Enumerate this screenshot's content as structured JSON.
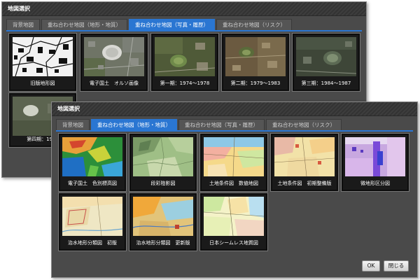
{
  "back_dialog": {
    "title": "地図選択",
    "tabs": [
      {
        "label": "背景地図",
        "active": false
      },
      {
        "label": "重ね合わせ地図（地形・地質）",
        "active": false
      },
      {
        "label": "重ね合わせ地図（写真・履歴）",
        "active": true
      },
      {
        "label": "重ね合わせ地図（リスク）",
        "active": false
      }
    ],
    "thumbnails": [
      {
        "caption": "旧版地形図",
        "image": "old-topographic-map"
      },
      {
        "caption": "電子国土　オルソ画像",
        "image": "ortho-aerial-photo"
      },
      {
        "caption": "第一期：1974～1978",
        "image": "aerial-photo-1974-1978"
      },
      {
        "caption": "第二期：1979～1983",
        "image": "aerial-photo-1979-1983"
      },
      {
        "caption": "第三期：1984～1987",
        "image": "aerial-photo-1984-1987"
      },
      {
        "caption": "第四期：1988",
        "image": "aerial-photo-1988"
      }
    ]
  },
  "front_dialog": {
    "title": "地図選択",
    "tabs": [
      {
        "label": "背景地図",
        "active": false
      },
      {
        "label": "重ね合わせ地図（地形・地質）",
        "active": true
      },
      {
        "label": "重ね合わせ地図（写真・履歴）",
        "active": false
      },
      {
        "label": "重ね合わせ地図（リスク）",
        "active": false
      }
    ],
    "thumbnails": [
      {
        "caption": "電子国土　色別標高図",
        "image": "color-elevation-map"
      },
      {
        "caption": "段彩陰影図",
        "image": "shaded-relief-map"
      },
      {
        "caption": "土地条件図　数値地図",
        "image": "land-condition-map-digital"
      },
      {
        "caption": "土地条件図　初期整備版",
        "image": "land-condition-map-initial"
      },
      {
        "caption": "微地形区分図",
        "image": "micro-landform-map"
      },
      {
        "caption": "治水地形分類図　初版",
        "image": "flood-control-map-first"
      },
      {
        "caption": "治水地形分類図　更新版",
        "image": "flood-control-map-updated"
      },
      {
        "caption": "日本シームレス地質図",
        "image": "seamless-geological-map"
      }
    ],
    "buttons": {
      "ok": "OK",
      "close": "閉じる"
    }
  },
  "colors": {
    "dialog_bg": "#4a4a4a",
    "active_tab": "#2a76d2",
    "thumb_border": "#0d0d0d"
  }
}
